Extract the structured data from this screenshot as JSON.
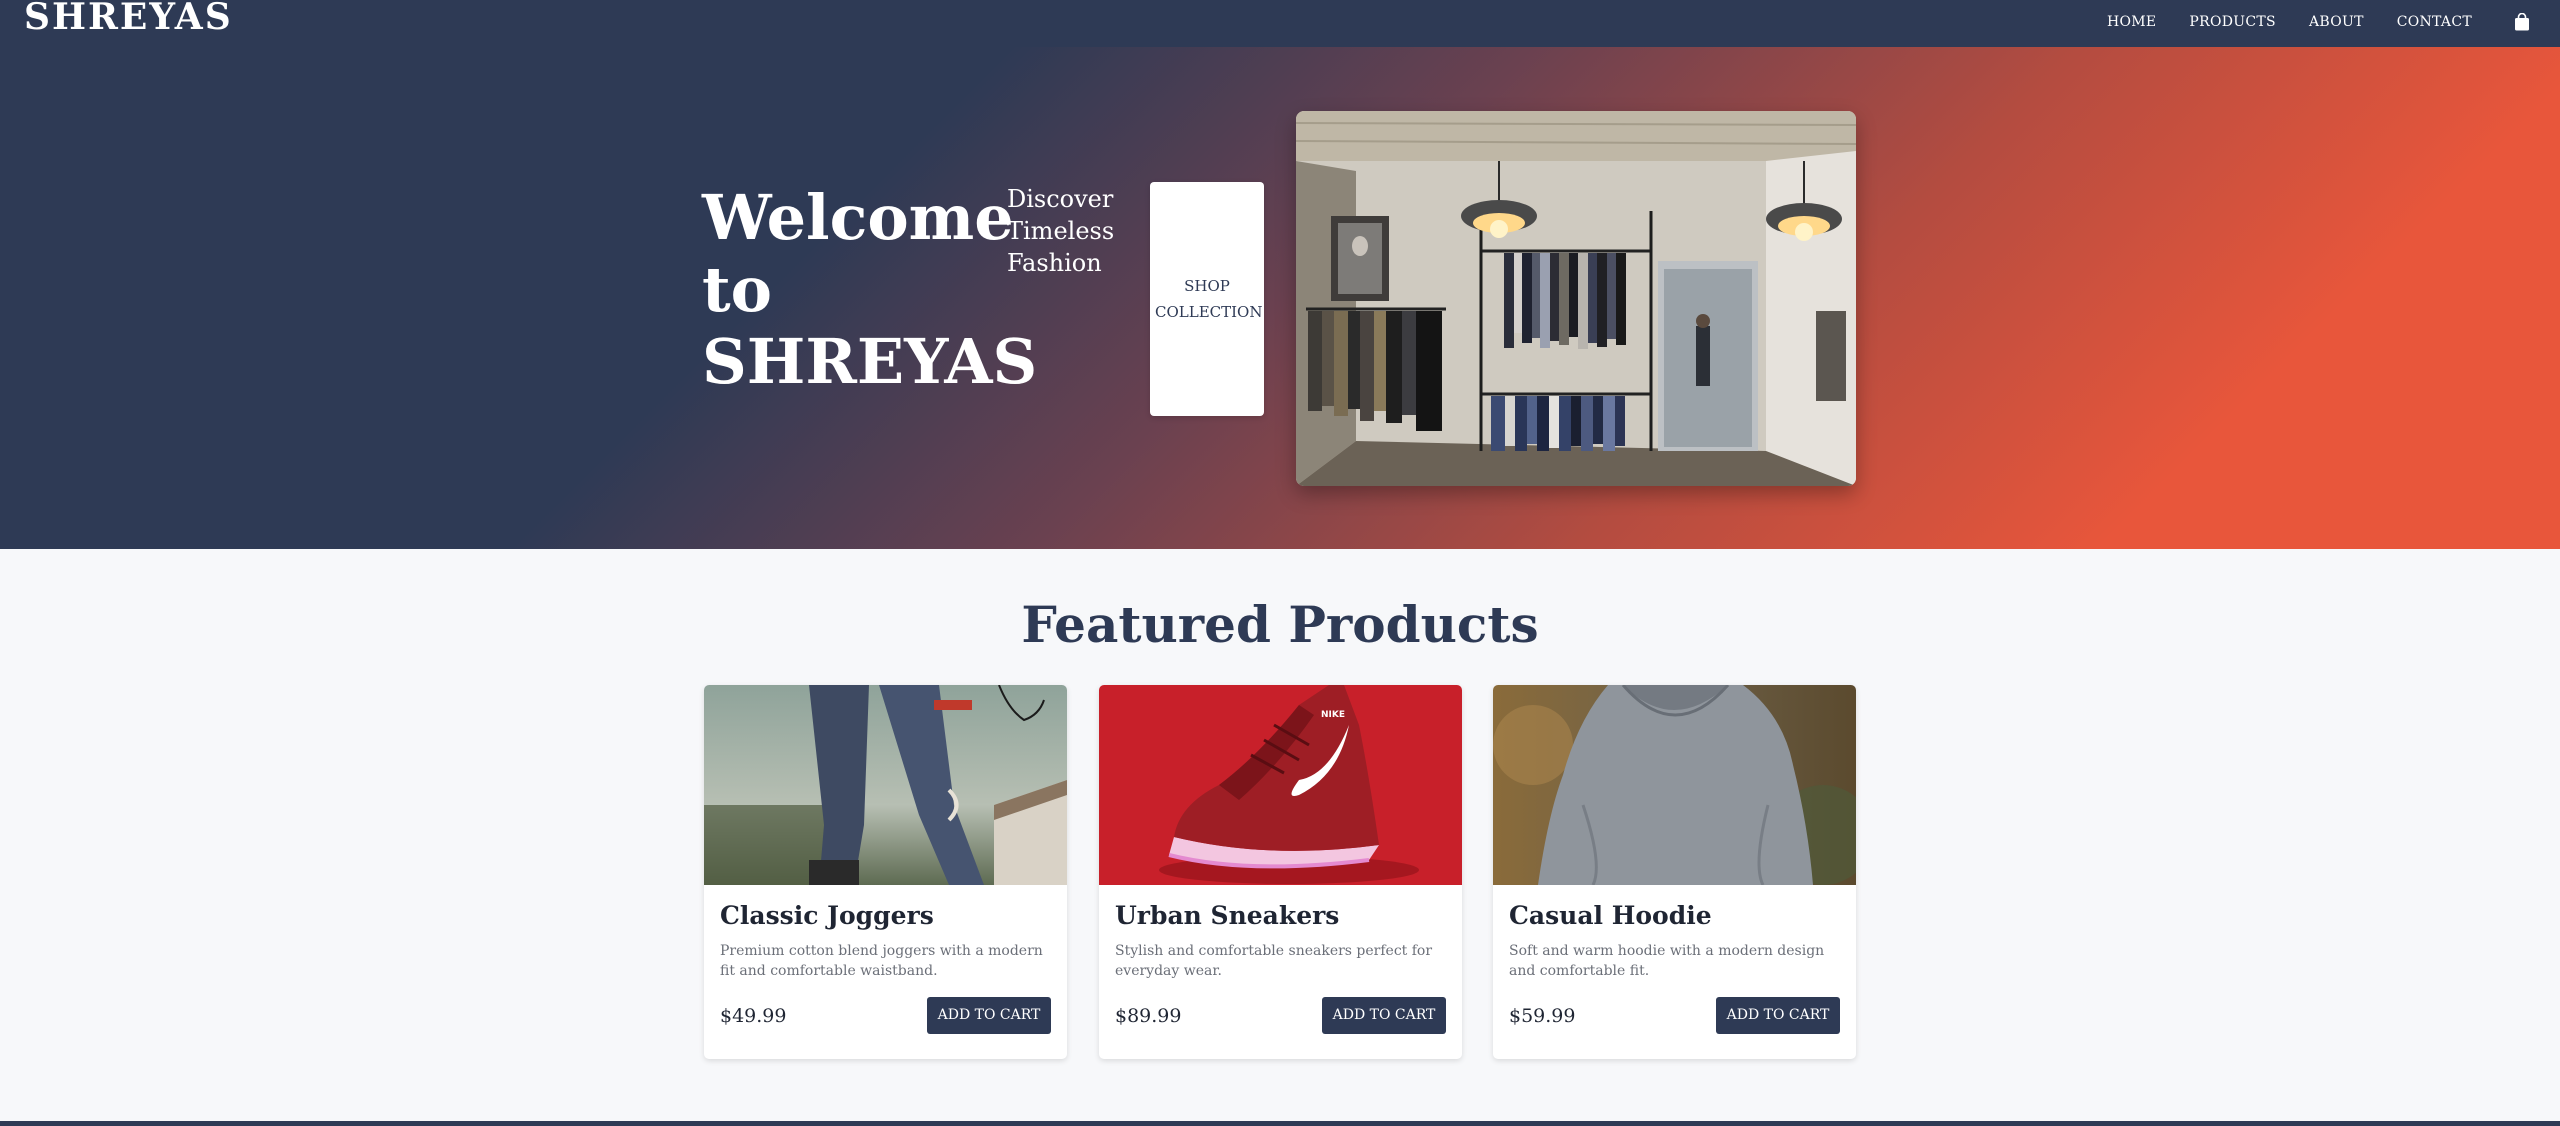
{
  "header": {
    "brand": "SHREYAS",
    "nav": [
      {
        "label": "HOME"
      },
      {
        "label": "PRODUCTS"
      },
      {
        "label": "ABOUT"
      },
      {
        "label": "CONTACT"
      }
    ],
    "cart_icon": "shopping-bag-icon",
    "background": "#2e3a55"
  },
  "hero": {
    "title": "Welcome to SHREYAS",
    "subtitle": "Discover Timeless Fashion",
    "button_label": "SHOP COLLECTION",
    "image_description_icon": "store-interior-photo",
    "gradient_start": "#2e3a55",
    "gradient_end": "#e8563b"
  },
  "featured": {
    "title": "Featured Products",
    "products": [
      {
        "name": "Classic Joggers",
        "description": "Premium cotton blend joggers with a modern fit and comfortable waistband.",
        "price": "$49.99",
        "button_label": "ADD TO CART",
        "image": "joggers-photo"
      },
      {
        "name": "Urban Sneakers",
        "description": "Stylish and comfortable sneakers perfect for everyday wear.",
        "price": "$89.99",
        "button_label": "ADD TO CART",
        "image": "sneaker-photo"
      },
      {
        "name": "Casual Hoodie",
        "description": "Soft and warm hoodie with a modern design and comfortable fit.",
        "price": "$59.99",
        "button_label": "ADD TO CART",
        "image": "hoodie-photo"
      }
    ]
  },
  "colors": {
    "primary": "#2e3a55",
    "accent": "#e8563b",
    "page_bg": "#f7f8fa"
  }
}
